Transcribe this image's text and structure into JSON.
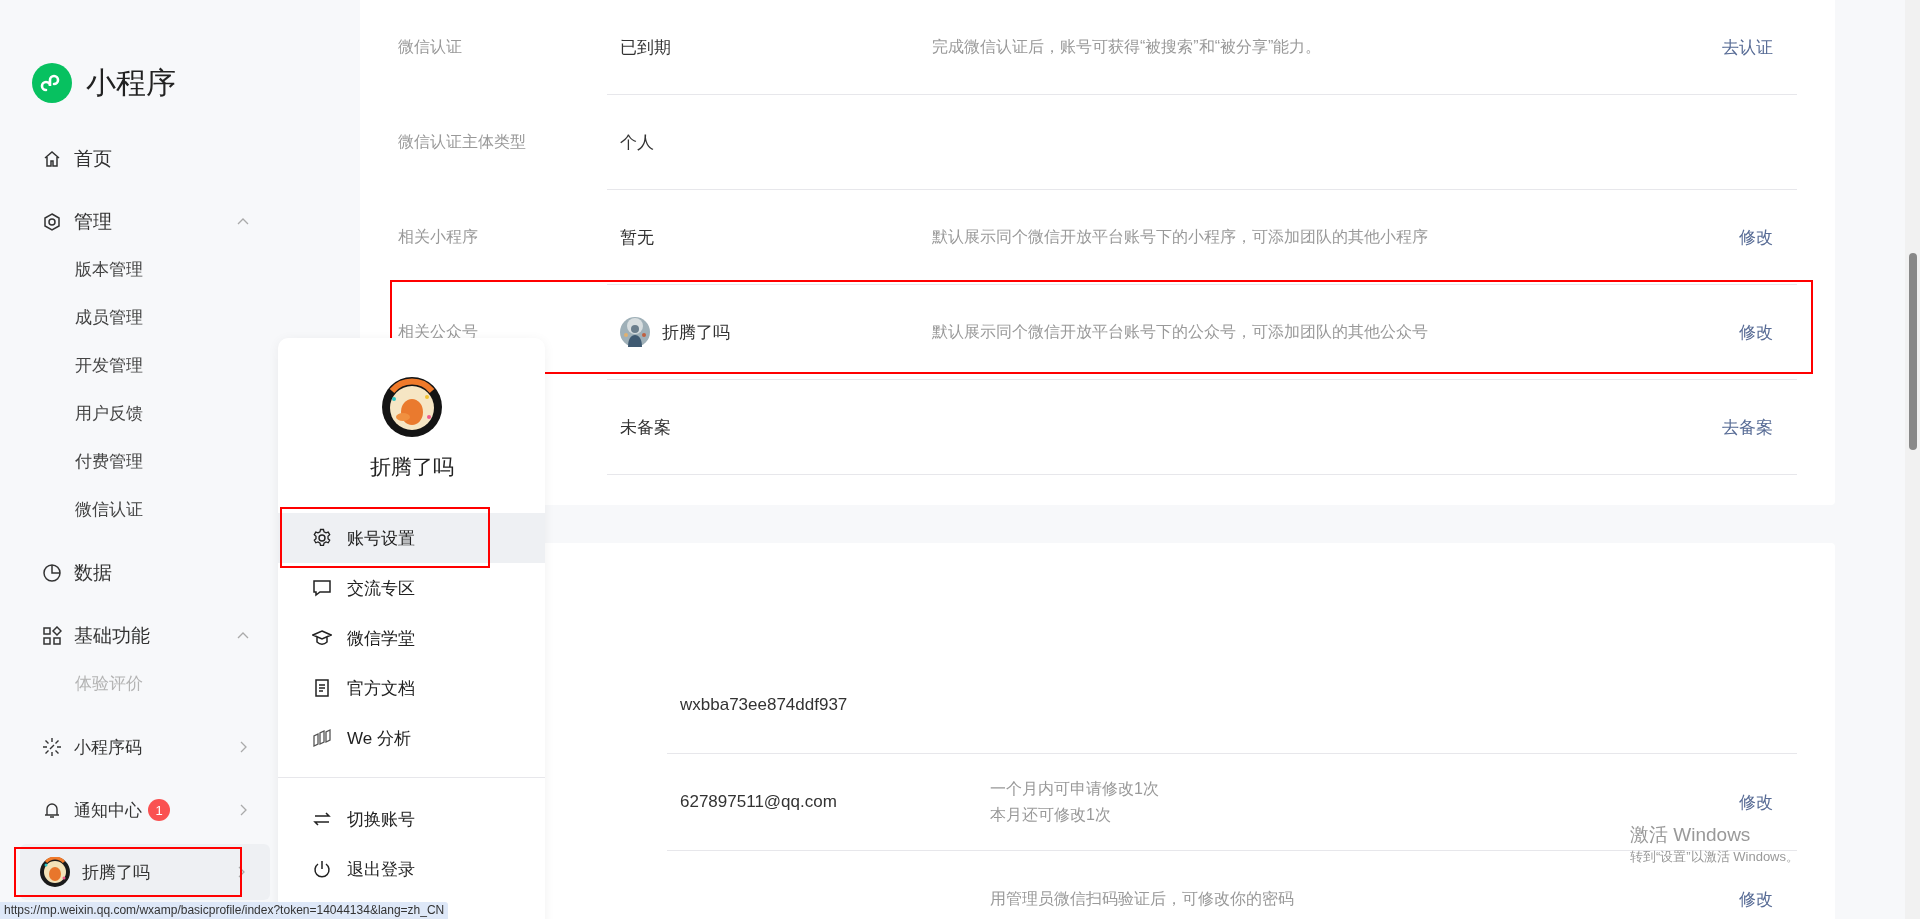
{
  "sidebar": {
    "logo": "小程序",
    "menu": [
      {
        "label": "首页"
      },
      {
        "label": "管理",
        "expanded": true,
        "children": [
          {
            "label": "版本管理",
            "dimmed": false
          },
          {
            "label": "成员管理",
            "dimmed": false
          },
          {
            "label": "开发管理",
            "dimmed": false
          },
          {
            "label": "用户反馈",
            "dimmed": false
          },
          {
            "label": "付费管理",
            "dimmed": false
          },
          {
            "label": "微信认证",
            "dimmed": false
          }
        ]
      },
      {
        "label": "数据"
      },
      {
        "label": "基础功能",
        "expanded": true,
        "children": [
          {
            "label": "体验评价",
            "dimmed": true
          }
        ]
      },
      {
        "label": "小程序码",
        "expanded": false
      },
      {
        "label": "通知中心",
        "expanded": false,
        "badge": "1"
      }
    ],
    "user": {
      "name": "折腾了吗",
      "highlighted": true
    }
  },
  "settings_card": {
    "rows": [
      {
        "label": "微信认证",
        "value": "已到期",
        "description": "完成微信认证后，账号可获得“被搜索”和“被分享”能力。",
        "action": "去认证",
        "kind": "text"
      },
      {
        "label": "微信认证主体类型",
        "value": "个人",
        "kind": "text"
      },
      {
        "label": "相关小程序",
        "value": "暂无",
        "description": "默认展示同个微信开放平台账号下的小程序，可添加团队的其他小程序",
        "action": "修改",
        "kind": "text"
      },
      {
        "label": "相关公众号",
        "value": "折腾了吗",
        "description": "默认展示同个微信开放平台账号下的公众号，可添加团队的其他公众号",
        "action": "修改",
        "highlighted": true,
        "kind": "account"
      },
      {
        "value": "未备案",
        "action": "去备案",
        "kind": "text"
      }
    ]
  },
  "account_card": {
    "rows": [
      {
        "value": "wxbba73ee874ddf937"
      },
      {
        "value": "627897511@qq.com",
        "description": [
          "一个月内可申请修改1次",
          "本月还可修改1次"
        ],
        "action": "修改"
      },
      {
        "description": [
          "用管理员微信扫码验证后，可修改你的密码"
        ],
        "action": "修改"
      }
    ]
  },
  "account_menu": {
    "name": "折腾了吗",
    "items": [
      {
        "label": "账号设置",
        "selected": true,
        "highlighted": true
      },
      {
        "label": "交流专区",
        "selected": false
      },
      {
        "label": "微信学堂",
        "selected": false
      },
      {
        "label": "官方文档",
        "selected": false
      },
      {
        "label": "We 分析",
        "selected": false
      }
    ],
    "footer_items": [
      {
        "label": "切换账号"
      },
      {
        "label": "退出登录"
      }
    ]
  },
  "status_url": "https://mp.weixin.qq.com/wxamp/basicprofile/index?token=14044134&lang=zh_CN",
  "os_watermark": {
    "title": "激活 Windows",
    "subtitle": "转到“设置”以激活 Windows。"
  }
}
